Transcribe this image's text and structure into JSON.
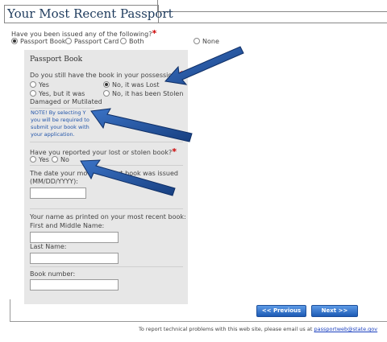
{
  "header": {
    "title": "Your Most Recent Passport"
  },
  "issued_question": {
    "label": "Have you been issued any of the following?",
    "required_mark": "*",
    "options": [
      "Passport Book",
      "Passport Card",
      "Both",
      "None"
    ],
    "selected": "Passport Book"
  },
  "book_panel": {
    "title": "Passport Book",
    "possession_question": "Do you still have the book in your possession?",
    "required_mark": "*",
    "possession_options": {
      "yes": "Yes",
      "lost": "No, it was Lost",
      "damaged_line1": "Yes, but it was",
      "damaged_line2": "Damaged or Mutilated",
      "stolen": "No, it has been Stolen"
    },
    "possession_selected": "No, it was Lost",
    "note_lines": [
      "NOTE! By selecting Y",
      "you will be required to",
      "submit your book with",
      "your application."
    ],
    "reported_question": "Have you reported your lost or stolen book?",
    "reported_options": [
      "Yes",
      "No"
    ],
    "date_label_line1": "The date your mo",
    "date_label_line1b": "sport book was issued",
    "date_label_line2": "(MM/DD/YYYY):",
    "date_value": "",
    "name_label_line1": "Your name as printed on your most recent book:",
    "name_label_line2": "First and Middle Name:",
    "first_middle_value": "",
    "last_name_label": "Last Name:",
    "last_name_value": "",
    "book_number_label": "Book number:",
    "book_number_value": ""
  },
  "nav": {
    "previous": "<< Previous",
    "next": "Next >>"
  },
  "footer": {
    "text": "To report technical problems with this web site, please email us at",
    "link": "passportweb@state.gov"
  },
  "colors": {
    "arrow": "#1f4f96",
    "panel": "#e7e7e7",
    "button": "#2d6cc4"
  }
}
